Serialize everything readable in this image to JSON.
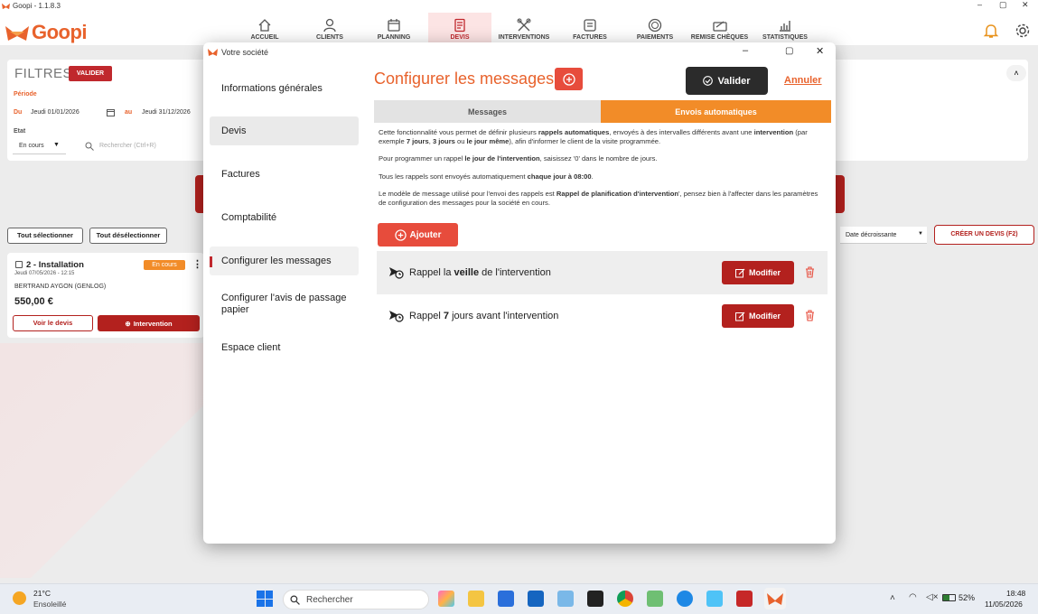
{
  "window": {
    "title": "Goopi - 1.1.8.3",
    "controls": [
      "–",
      "▢",
      "✕"
    ]
  },
  "brand": {
    "name": "Goopi"
  },
  "nav": [
    {
      "label": "ACCUEIL",
      "icon": "home-icon"
    },
    {
      "label": "CLIENTS",
      "icon": "user-icon"
    },
    {
      "label": "PLANNING",
      "icon": "calendar-icon"
    },
    {
      "label": "DEVIS",
      "icon": "quote-icon",
      "active": true
    },
    {
      "label": "INTERVENTIONS",
      "icon": "tools-icon"
    },
    {
      "label": "FACTURES",
      "icon": "invoice-icon"
    },
    {
      "label": "PAIEMENTS",
      "icon": "coin-icon"
    },
    {
      "label": "REMISE CHÈQUES",
      "icon": "cheque-icon"
    },
    {
      "label": "STATISTIQUES",
      "icon": "stats-icon"
    }
  ],
  "filters": {
    "title": "FILTRES",
    "validate": "VALIDER",
    "periode_label": "Période",
    "du": "Du",
    "date_from": "Jeudi 01/01/2026",
    "au": "au",
    "date_to": "Jeudi 31/12/2026",
    "etat_label": "Etat",
    "etat_value": "En cours",
    "search_placeholder": "Rechercher (Ctrl+R)"
  },
  "list": {
    "select_all": "Tout sélectionner",
    "deselect_all": "Tout désélectionner",
    "sort": "Date décroissante",
    "create": "CRÉER UN DEVIS (F2)"
  },
  "card": {
    "title": "2 - Installation",
    "status": "En cours",
    "date": "Jeudi 07/05/2026 - 12:15",
    "client": "BERTRAND AYGON (GENLOG)",
    "amount": "550,00 €",
    "view": "Voir le devis",
    "intervention": "Intervention"
  },
  "dialog": {
    "title": "Votre société",
    "sidebar": [
      "Informations générales",
      "Devis",
      "Factures",
      "Comptabilité",
      "Configurer les messages",
      "Configurer l'avis de passage papier",
      "Espace client"
    ],
    "heading": "Configurer les messages",
    "validate": "Valider",
    "cancel": "Annuler",
    "tabs": [
      "Messages",
      "Envois automatiques"
    ],
    "paragraphs": {
      "p1_a": "Cette fonctionnalité vous permet de définir plusieurs ",
      "p1_b": "rappels automatiques",
      "p1_c": ", envoyés à des intervalles différents avant une ",
      "p1_d": "intervention",
      "p1_e": " (par exemple ",
      "p1_f": "7 jours",
      "p1_g": ", ",
      "p1_h": "3 jours",
      "p1_i": " ou ",
      "p1_j": "le jour même",
      "p1_k": "), afin d'informer le client de la visite programmée.",
      "p2_a": "Pour programmer un rappel ",
      "p2_b": "le jour de l'intervention",
      "p2_c": ", saisissez '0' dans le nombre de jours.",
      "p3_a": "Tous les rappels sont envoyés automatiquement ",
      "p3_b": "chaque jour à 08:00",
      "p3_c": ".",
      "p4_a": "Le modèle de message utilisé pour l'envoi des rappels est ",
      "p4_b": "Rappel de planification d'intervention",
      "p4_c": "', pensez bien à l'affecter dans les paramètres de configuration des messages pour la société en cours."
    },
    "add": "Ajouter",
    "reminders": [
      {
        "pre": "Rappel la ",
        "bold": "veille",
        "post": " de l'intervention",
        "action": "Modifier"
      },
      {
        "pre": "Rappel ",
        "bold": "7",
        "post": " jours avant l'intervention",
        "action": "Modifier"
      }
    ]
  },
  "taskbar": {
    "weather_temp": "21°C",
    "weather_desc": "Ensoleillé",
    "search": "Rechercher",
    "battery": "52%",
    "time": "18:48",
    "date": "11/05/2026"
  },
  "colors": {
    "accent": "#e8622c",
    "red": "#b3211e",
    "orange_tab": "#f28c28",
    "dark": "#2b2b2b"
  }
}
